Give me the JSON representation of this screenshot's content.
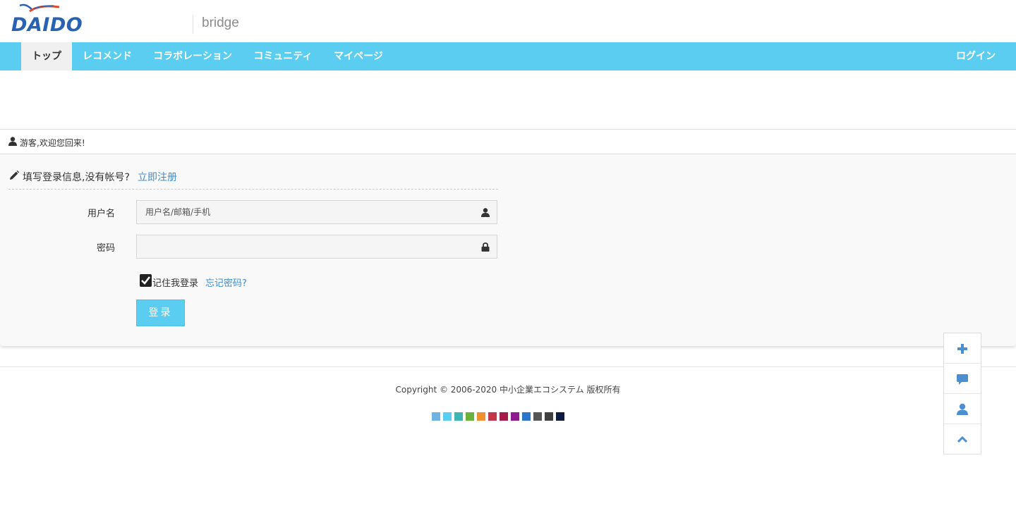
{
  "header": {
    "logo_text": "DAIDO",
    "site_name": "bridge"
  },
  "nav": {
    "items": [
      {
        "label": "トップ",
        "active": true
      },
      {
        "label": "レコメンド",
        "active": false
      },
      {
        "label": "コラボレーション",
        "active": false
      },
      {
        "label": "コミュニティ",
        "active": false
      },
      {
        "label": "マイページ",
        "active": false
      }
    ],
    "login_label": "ログイン"
  },
  "welcome": {
    "text": "游客,欢迎您回来!",
    "icon": "user-icon"
  },
  "login_form": {
    "title": "填写登录信息,没有帐号?",
    "title_icon": "pencil-icon",
    "register_link": "立即注册",
    "username_label": "用户名",
    "username_placeholder": "用户名/邮箱/手机",
    "username_value": "",
    "username_icon": "user-icon",
    "password_label": "密码",
    "password_value": "",
    "password_icon": "lock-icon",
    "remember_label": "记住我登录",
    "remember_checked": true,
    "forgot_link": "忘记密码?",
    "submit_label": "登录"
  },
  "footer": {
    "copyright": "Copyright © 2006-2020 中小企業エコシステム 版权所有",
    "theme_colors": [
      "#6fb3e0",
      "#5bcdf1",
      "#3fb5b1",
      "#6ab23b",
      "#f0902f",
      "#c4384b",
      "#a41d4a",
      "#8c1c8f",
      "#2c77c9",
      "#555555",
      "#404040",
      "#0f1c40"
    ]
  },
  "float_toolbar": {
    "buttons": [
      "plus-icon",
      "comment-icon",
      "user-icon",
      "chevron-up-icon"
    ],
    "icon_color": "#4c8fd1"
  }
}
